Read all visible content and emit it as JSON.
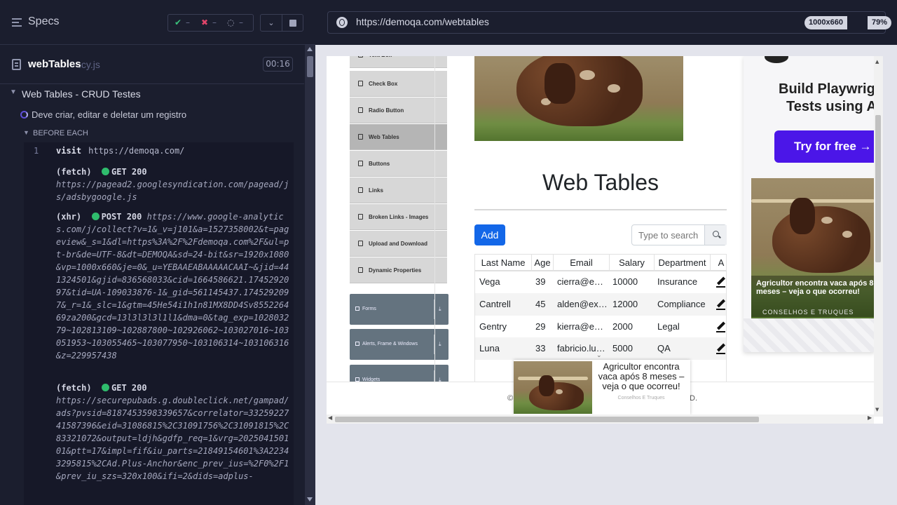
{
  "runner": {
    "specs_label": "Specs",
    "stats": {
      "passed": "–",
      "failed": "–",
      "pending": "–"
    },
    "colors": {
      "pass": "#3ac27b",
      "fail": "#e0456a",
      "running": "#5f4fd8"
    }
  },
  "spec": {
    "name": "webTables",
    "ext": ".cy.js",
    "time": "00:16"
  },
  "suite": {
    "title": "Web Tables - CRUD Testes",
    "test": "Deve criar, editar e deletar um registro",
    "hook": "BEFORE EACH"
  },
  "commands": [
    {
      "num": "1",
      "keyword": "visit",
      "text": "https://demoqa.com/"
    },
    {
      "prefix": "(fetch)",
      "status": "GET 200",
      "text": "https://pagead2.googlesyndication.com/pagead/js/adsbygoogle.js"
    },
    {
      "prefix": "(xhr)",
      "status": "POST 200",
      "text": "https://www.google-analytics.com/j/collect?v=1&_v=j101&a=1527358002&t=pageview&_s=1&dl=https%3A%2F%2Fdemoqa.com%2F&ul=pt-br&de=UTF-8&dt=DEMOQA&sd=24-bit&sr=1920x1080&vp=1000x660&je=0&_u=YEBAAEABAAAAACAAI~&jid=441324501&gjid=836568033&cid=1664586621.1745292097&tid=UA-109033876-1&_gid=561145437.1745292097&_r=1&_slc=1&gtm=45He54i1h1n81MX8DD4Sv855226469za200&gcd=13l3l3l3l1l1&dma=0&tag_exp=102803279~102813109~102887800~102926062~103027016~103051953~103055465~103077950~103106314~103106316&z=229957438"
    },
    {
      "prefix": "(fetch)",
      "status": "GET 200",
      "text": "https://securepubads.g.doubleclick.net/gampad/ads?pvsid=8187453598339657&correlator=3325922741587396&eid=31086815%2C31091756%2C31091815%2C83321072&output=ldjh&gdfp_req=1&vrg=202504150101&ptt=17&impl=fif&iu_parts=21849154601%3A22343295815%2CAd.Plus-Anchor&enc_prev_ius=%2F0%2F1&prev_iu_szs=320x100&ifi=2&dids=adplus-"
    }
  ],
  "browser": {
    "url": "https://demoqa.com/webtables",
    "viewport": "1000x660",
    "zoom": "79%"
  },
  "sidebar": {
    "items": [
      {
        "label": "Text Box",
        "icon": "file-icon"
      },
      {
        "label": "Check Box",
        "icon": "file-icon"
      },
      {
        "label": "Radio Button",
        "icon": "file-icon"
      },
      {
        "label": "Web Tables",
        "icon": "file-icon",
        "active": true
      },
      {
        "label": "Buttons",
        "icon": "file-icon"
      },
      {
        "label": "Links",
        "icon": "file-icon"
      },
      {
        "label": "Broken Links - Images",
        "icon": "file-icon"
      },
      {
        "label": "Upload and Download",
        "icon": "file-icon"
      },
      {
        "label": "Dynamic Properties",
        "icon": "file-icon"
      }
    ],
    "groups": [
      {
        "label": "Forms"
      },
      {
        "label": "Alerts, Frame & Windows"
      },
      {
        "label": "Widgets"
      }
    ]
  },
  "page": {
    "title": "Web Tables",
    "add_label": "Add",
    "search_placeholder": "Type to search",
    "accent": "#1367e8"
  },
  "table": {
    "headers": [
      "Last Name",
      "Age",
      "Email",
      "Salary",
      "Department",
      "A"
    ],
    "rows": [
      [
        "Vega",
        "39",
        "cierra@e…",
        "10000",
        "Insurance"
      ],
      [
        "Cantrell",
        "45",
        "alden@ex…",
        "12000",
        "Compliance"
      ],
      [
        "Gentry",
        "29",
        "kierra@e…",
        "2000",
        "Legal"
      ],
      [
        "Luna",
        "33",
        "fabricio.lu…",
        "5000",
        "QA"
      ]
    ]
  },
  "footer": {
    "text": "©",
    "text_end": "D."
  },
  "popup_ad": {
    "text": "Agricultor encontra vaca após 8 meses – veja o que ocorreu!",
    "source": "Conselhos E Truques"
  },
  "side_ad": {
    "title": "Build Playwrig… Tests using A…",
    "title_line1": "Build Playwrig",
    "title_line2": "Tests using A",
    "cta": "Try for free →",
    "caption": "Agricultor encontra vaca após 8 meses – veja o que ocorreu!",
    "source": "CONSELHOS E TRUQUES",
    "cta_color": "#4b16e8"
  }
}
